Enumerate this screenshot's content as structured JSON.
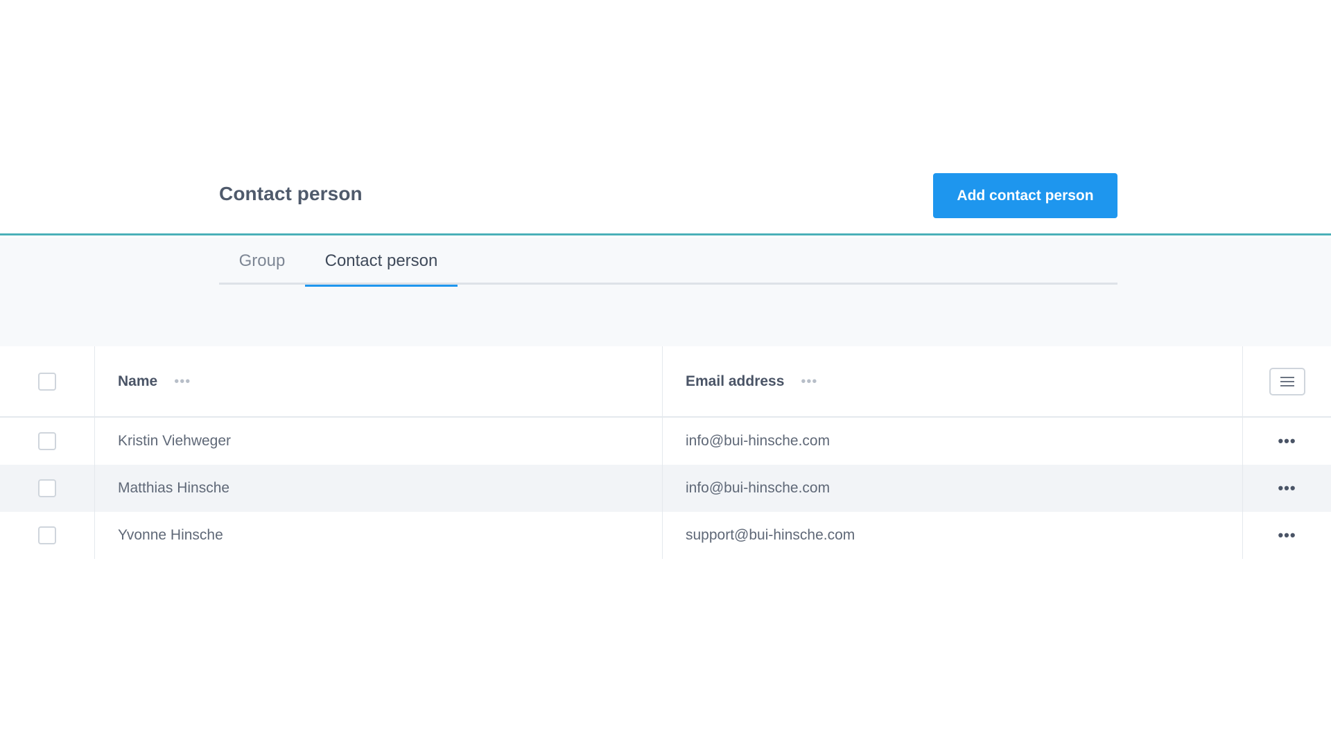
{
  "header": {
    "title": "Contact person",
    "add_button_label": "Add contact person"
  },
  "tabs": [
    {
      "label": "Group",
      "active": false
    },
    {
      "label": "Contact person",
      "active": true
    }
  ],
  "table": {
    "columns": [
      {
        "label": "Name",
        "menu_icon": "ellipsis-icon"
      },
      {
        "label": "Email address",
        "menu_icon": "ellipsis-icon"
      }
    ],
    "columns_button_icon": "list-icon",
    "row_menu_label": "•••",
    "column_menu_label": "•••",
    "rows": [
      {
        "name": "Kristin Viehweger",
        "email": "info@bui-hinsche.com"
      },
      {
        "name": "Matthias Hinsche",
        "email": "info@bui-hinsche.com"
      },
      {
        "name": "Yvonne Hinsche",
        "email": "support@bui-hinsche.com"
      }
    ]
  },
  "colors": {
    "accent": "#1e96ee",
    "header_border": "#4ab0b8",
    "row_alt": "#f2f4f7"
  }
}
